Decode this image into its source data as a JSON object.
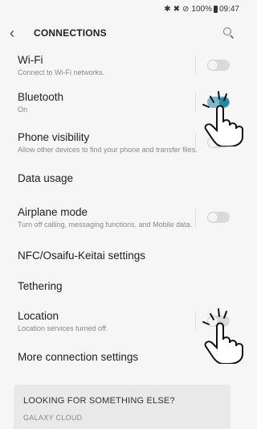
{
  "status_bar": {
    "icons": [
      "bluetooth-icon",
      "signal-icon",
      "mute-icon"
    ],
    "battery": "100%",
    "time": "09:47"
  },
  "header": {
    "title": "CONNECTIONS"
  },
  "settings": {
    "wifi": {
      "label": "Wi-Fi",
      "sub": "Connect to Wi-Fi networks.",
      "on": false
    },
    "bluetooth": {
      "label": "Bluetooth",
      "sub": "On",
      "on": true
    },
    "visibility": {
      "label": "Phone visibility",
      "sub": "Allow other devices to find your phone and transfer files.",
      "on": false
    },
    "data_usage": {
      "label": "Data usage"
    },
    "airplane": {
      "label": "Airplane mode",
      "sub": "Turn off calling, messaging functions, and Mobile data.",
      "on": false
    },
    "nfc": {
      "label": "NFC/Osaifu-Keitai settings"
    },
    "tethering": {
      "label": "Tethering"
    },
    "location": {
      "label": "Location",
      "sub": "Location services turned off.",
      "on": false
    },
    "more": {
      "label": "More connection settings"
    }
  },
  "suggestions": {
    "heading": "LOOKING FOR SOMETHING ELSE?",
    "link": "GALAXY CLOUD"
  },
  "colors": {
    "accent": "#1f89a6",
    "background": "#f6f6f6"
  }
}
